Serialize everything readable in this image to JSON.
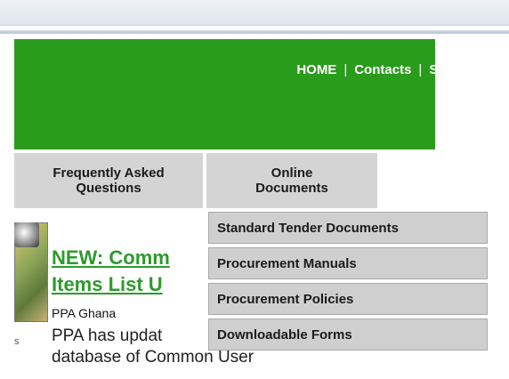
{
  "header": {
    "nav": [
      {
        "label": "HOME"
      },
      {
        "label": "Contacts"
      },
      {
        "label": "Site Map"
      }
    ],
    "separator": "|",
    "background_color": "#2a9c1c"
  },
  "menu": {
    "tabs": [
      {
        "line1": "Frequently Asked",
        "line2": "Questions"
      },
      {
        "line1": "Online",
        "line2": "Documents"
      }
    ],
    "dropdown": [
      "Standard Tender Documents",
      "Procurement Manuals",
      "Procurement Policies",
      "Downloadable Forms"
    ]
  },
  "news": {
    "title_line1": "NEW: Comm",
    "title_line2": "Items List U",
    "source": "PPA Ghana",
    "body_line1": "PPA has updat",
    "body_line2": "database of Common User",
    "bullet": "s",
    "link_color": "#2e9a2c"
  }
}
